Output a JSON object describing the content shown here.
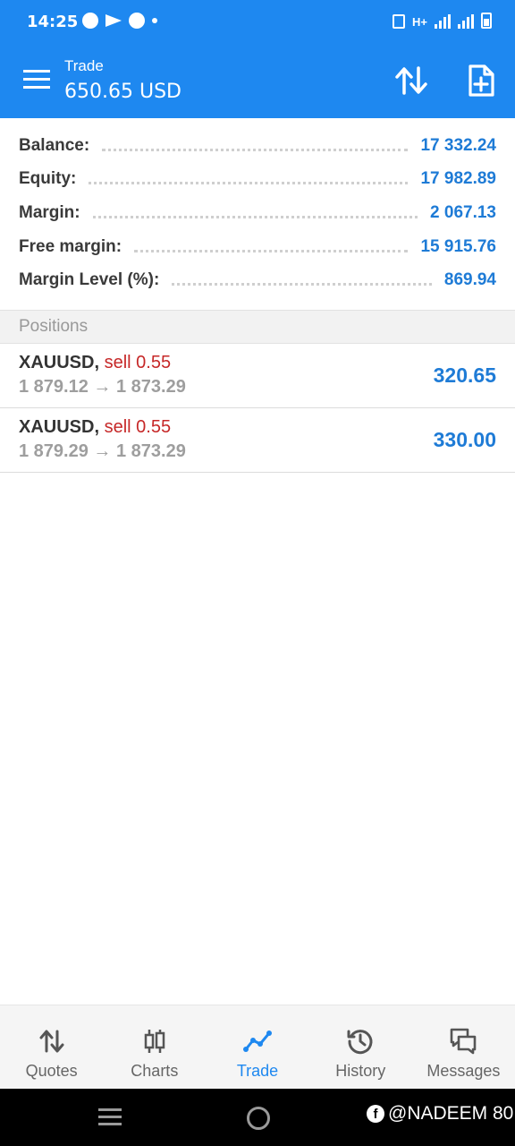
{
  "status_bar": {
    "time": "14:25",
    "network": "H+"
  },
  "app_bar": {
    "title": "Trade",
    "balance": "650.65 USD"
  },
  "summary": [
    {
      "label": "Balance:",
      "value": "17 332.24"
    },
    {
      "label": "Equity:",
      "value": "17 982.89"
    },
    {
      "label": "Margin:",
      "value": "2 067.13"
    },
    {
      "label": "Free margin:",
      "value": "15 915.76"
    },
    {
      "label": "Margin Level (%):",
      "value": "869.94"
    }
  ],
  "positions_header": "Positions",
  "positions": [
    {
      "symbol": "XAUUSD,",
      "side": "sell 0.55",
      "prices": "1 879.12 → 1 873.29",
      "profit": "320.65"
    },
    {
      "symbol": "XAUUSD,",
      "side": "sell 0.55",
      "prices": "1 879.29 → 1 873.29",
      "profit": "330.00"
    }
  ],
  "bottom_nav": [
    {
      "label": "Quotes",
      "icon": "quotes-arrows-icon",
      "active": false
    },
    {
      "label": "Charts",
      "icon": "candlestick-icon",
      "active": false
    },
    {
      "label": "Trade",
      "icon": "trade-trend-icon",
      "active": true
    },
    {
      "label": "History",
      "icon": "history-clock-icon",
      "active": false
    },
    {
      "label": "Messages",
      "icon": "messages-icon",
      "active": false
    }
  ],
  "watermark": "@NADEEM 80",
  "colors": {
    "primary": "#1e88f0",
    "value_blue": "#1e7bd6",
    "sell_red": "#c62828"
  }
}
